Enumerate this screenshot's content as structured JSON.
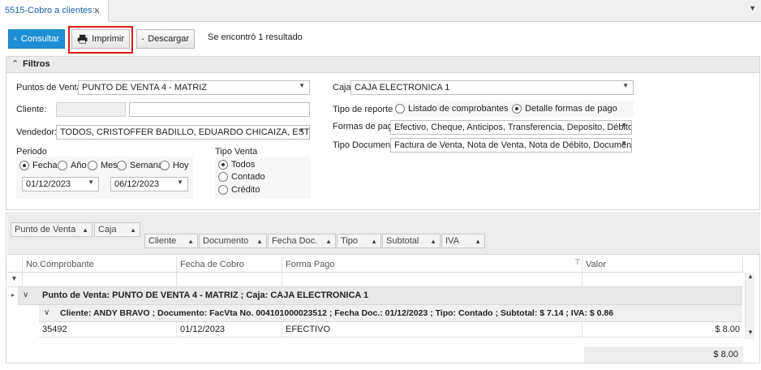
{
  "tab": {
    "title": "5515-Cobro a clientes::.",
    "close": "×",
    "menu": "▼"
  },
  "toolbar": {
    "consultar": "Consultar",
    "imprimir": "Imprimir",
    "descargar": "Descargar",
    "result": "Se encontró 1 resultado"
  },
  "filtros": {
    "title": "Filtros",
    "puntos_venta_label": "Puntos de Venta:",
    "puntos_venta_value": "PUNTO DE VENTA 4 - MATRIZ",
    "cliente_label": "Cliente:",
    "vendedor_label": "Vendedor:",
    "vendedor_value": "TODOS, CRISTOFFER BADILLO, EDUARDO CHICAIZA, ESTEBAN SAN ...",
    "periodo_label": "Periodo",
    "periodo_options": [
      "Fecha",
      "Año",
      "Mes",
      "Semana",
      "Hoy"
    ],
    "fecha_desde": "01/12/2023",
    "fecha_hasta": "06/12/2023",
    "tipo_venta_label": "Tipo Venta",
    "tipo_venta_options": [
      "Todos",
      "Contado",
      "Crédito"
    ],
    "caja_label": "Caja:",
    "caja_value": "CAJA ELECTRONICA 1",
    "tipo_reporte_label": "Tipo de reporte:",
    "tipo_reporte_options": [
      "Listado de comprobantes",
      "Detalle formas de pago"
    ],
    "formas_pago_label": "Formas de pago",
    "formas_pago_value": "Efectivo, Cheque, Anticipos, Transferencia, Deposito, Débito Ban...",
    "tipo_documento_label": "Tipo Documento",
    "tipo_documento_value": "Factura de Venta, Nota de Venta, Nota de Débito, Documento de..."
  },
  "grid": {
    "group_chips_row1": [
      "Punto de Venta",
      "Caja"
    ],
    "group_chips_row2": [
      "Cliente",
      "Documento",
      "Fecha Doc.",
      "Tipo",
      "Subtotal",
      "IVA"
    ],
    "columns": [
      "No.Comprobante",
      "Fecha de Cobro",
      "Forma Pago",
      "Valor"
    ],
    "group1": "Punto de Venta: PUNTO DE VENTA 4 - MATRIZ ; Caja: CAJA ELECTRONICA 1",
    "group2": "Cliente: ANDY BRAVO ; Documento: FacVta No. 004101000023512 ; Fecha Doc.: 01/12/2023 ; Tipo: Contado ; Subtotal: $ 7.14 ; IVA: $ 0.86",
    "rows": [
      {
        "comprobante": "35492",
        "fecha": "01/12/2023",
        "forma": "EFECTIVO",
        "valor": "$ 8.00"
      }
    ],
    "total": "$ 8.00"
  }
}
